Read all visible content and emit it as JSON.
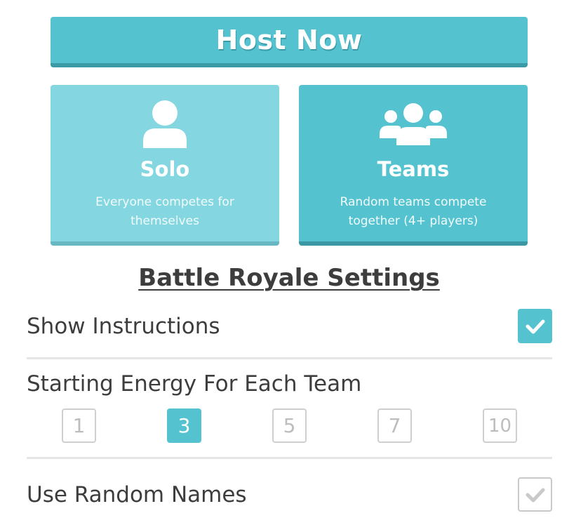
{
  "host_button": {
    "label": "Host Now"
  },
  "modes": [
    {
      "title": "Solo",
      "description": "Everyone competes for themselves",
      "icon": "user-icon"
    },
    {
      "title": "Teams",
      "description": "Random teams compete together (4+ players)",
      "icon": "users-icon"
    }
  ],
  "settings": {
    "title": "Battle Royale Settings",
    "show_instructions": {
      "label": "Show Instructions",
      "checked": true
    },
    "starting_energy": {
      "label": "Starting Energy For Each Team",
      "options": [
        "1",
        "3",
        "5",
        "7",
        "10"
      ],
      "selected": "3"
    },
    "random_names": {
      "label": "Use Random Names",
      "checked": false
    }
  },
  "colors": {
    "accent": "#55c3cf",
    "accent_light": "#84d7e0",
    "accent_dark": "#3a9aa6",
    "text": "#3d3d3d"
  }
}
